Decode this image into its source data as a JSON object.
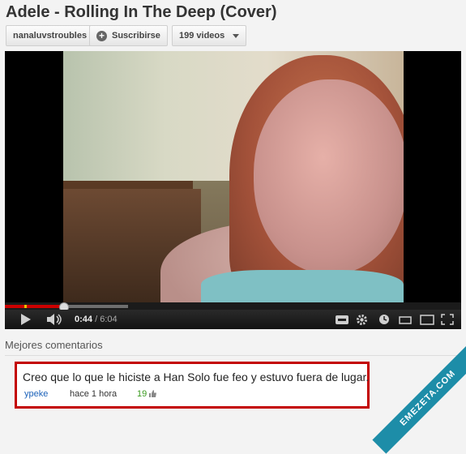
{
  "video": {
    "title": "Adele - Rolling In The Deep (Cover)",
    "time_current": "0:44",
    "time_total": "/ 6:04",
    "progress_played_fraction": 0.13,
    "progress_buffered_fraction": 0.27
  },
  "channel": {
    "name": "nanaluvstroubles",
    "subscribe_label": "Suscribirse",
    "videos_label": "199 videos"
  },
  "comments": {
    "section_label": "Mejores comentarios",
    "top": {
      "text": "Creo que lo que le hiciste a Han Solo fue feo y estuvo fuera de lugar.",
      "user": "ypeke",
      "time": "hace 1 hora",
      "likes": "19"
    }
  },
  "watermark": "EMEZETA.COM",
  "colors": {
    "accent_red": "#cc0000",
    "link_blue": "#1c62b9",
    "like_green": "#3a9a1f",
    "ribbon": "#1d8da8"
  },
  "icons": [
    "play-icon",
    "volume-icon",
    "captions-icon",
    "gear-icon",
    "watch-later-icon",
    "small-player-icon",
    "large-player-icon",
    "fullscreen-icon",
    "thumbs-up-icon",
    "plus-icon",
    "chevron-down-icon"
  ]
}
